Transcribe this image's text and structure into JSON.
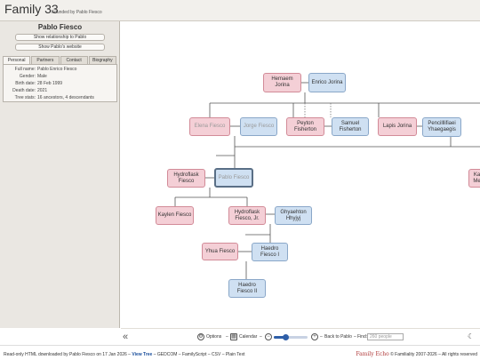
{
  "header": {
    "title": "Family 33",
    "founder": "Founded by Pablo Fiesco"
  },
  "sidebar": {
    "person_name": "Pablo Fiesco",
    "buttons": [
      "Show relationship to Pablo",
      "Show Pablo's website"
    ],
    "tabs": [
      "Personal",
      "Partners",
      "Contact",
      "Biography"
    ],
    "details": [
      {
        "label": "Full name:",
        "value": "Pablo Enrico Fiesco"
      },
      {
        "label": "Gender:",
        "value": "Male"
      },
      {
        "label": "Birth date:",
        "value": "28 Feb 1999"
      },
      {
        "label": "Death date:",
        "value": "2021"
      },
      {
        "label": "Tree stats:",
        "value": "16 ancestors, 4 descendants"
      }
    ]
  },
  "tree": {
    "hemaem": "Hemaem Jorina",
    "enrico": "Enrico Jorina",
    "elena": "Elena Fiesco",
    "jorge": "Jorge Fiesco",
    "peyton": "Peyton Fisherton",
    "samuel": "Samuel Fisherton",
    "lapis": "Lapis Jorina",
    "pencil": "Pencilllifiaei Yhaegaegis",
    "hydroflask": "Hydroflask Fiesco",
    "pablo": "Pablo Fiesco",
    "kar": "Kar Mer",
    "kaylen": "Kaylen Fiesco",
    "hydroflask_jr": "Hydroflask Fiesco, Jr.",
    "ghyae": "Ghyaehton Hhyjyj",
    "yhua": "Yhua Fiesco",
    "haedro1": "Haedro Fiesco I",
    "haedro2": "Haedro Fiesco II"
  },
  "toolbar": {
    "options": "Options",
    "calendar": "Calendar",
    "back": "Back to Pablo",
    "find_label": "Find:",
    "find_placeholder": "260 people",
    "zoom_level": 0.35
  },
  "footer": {
    "prefix": "Read-only HTML downloaded by Pablo Fiesco on 17 Jan 2026 –",
    "links": [
      "View Tree",
      "GEDCOM",
      "FamilyScript",
      "CSV",
      "Plain Text"
    ],
    "brand": "Family Echo",
    "copyright": "© Familiality 2007-2026 – All rights reserved"
  },
  "colors": {
    "female": "#f4cfd6",
    "male": "#cfe0f2",
    "link": "#1b4f9c",
    "brand": "#b03a3a"
  }
}
